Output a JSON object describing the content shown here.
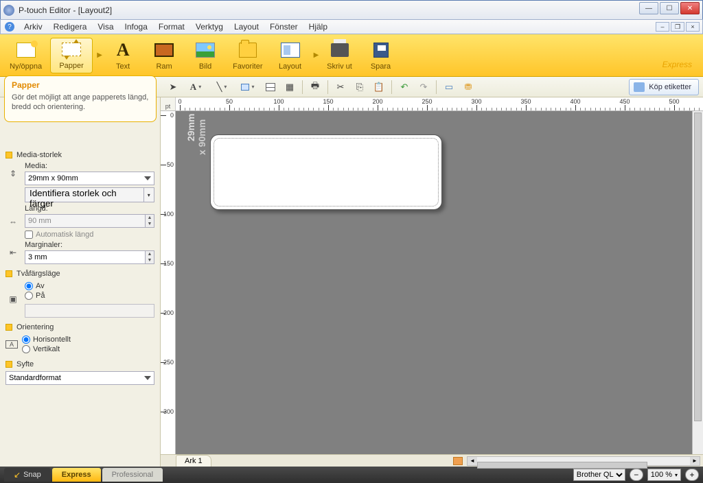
{
  "window": {
    "title": "P-touch Editor - [Layout2]"
  },
  "menu": {
    "items": [
      "Arkiv",
      "Redigera",
      "Visa",
      "Infoga",
      "Format",
      "Verktyg",
      "Layout",
      "Fönster",
      "Hjälp"
    ]
  },
  "ribbon": {
    "new_open": "Ny/öppna",
    "paper": "Papper",
    "text": "Text",
    "frame": "Ram",
    "image": "Bild",
    "favorites": "Favoriter",
    "layout": "Layout",
    "print": "Skriv ut",
    "save": "Spara",
    "mode_label": "Express"
  },
  "info_box": {
    "title": "Papper",
    "desc": "Gör det möjligt att ange papperets längd, bredd och orientering."
  },
  "toolbar2": {
    "buy_labels": "Köp etiketter"
  },
  "side": {
    "media_size_title": "Media-storlek",
    "media_label": "Media:",
    "media_value": "29mm x 90mm",
    "identify_btn": "Identifiera storlek och färger",
    "length_label": "Längd:",
    "length_value": "90 mm",
    "auto_length": "Automatisk längd",
    "margins_label": "Marginaler:",
    "margins_value": "3 mm",
    "twocolor_title": "Tvåfärgsläge",
    "off": "Av",
    "on": "På",
    "orient_title": "Orientering",
    "horiz": "Horisontellt",
    "vert": "Vertikalt",
    "purpose_title": "Syfte",
    "purpose_value": "Standardformat"
  },
  "canvas": {
    "ruler_unit": "pt",
    "h_ticks": [
      "0",
      "50",
      "100",
      "150",
      "200",
      "250",
      "300",
      "350",
      "400",
      "450",
      "500"
    ],
    "v_ticks": [
      "0",
      "50",
      "100",
      "150",
      "200",
      "250",
      "300"
    ],
    "dim1": "29mm",
    "dim2": "x 90mm",
    "sheet_tab": "Ark 1"
  },
  "status": {
    "snap": "Snap",
    "express": "Express",
    "professional": "Professional",
    "printer": "Brother QL",
    "zoom": "100 %"
  }
}
